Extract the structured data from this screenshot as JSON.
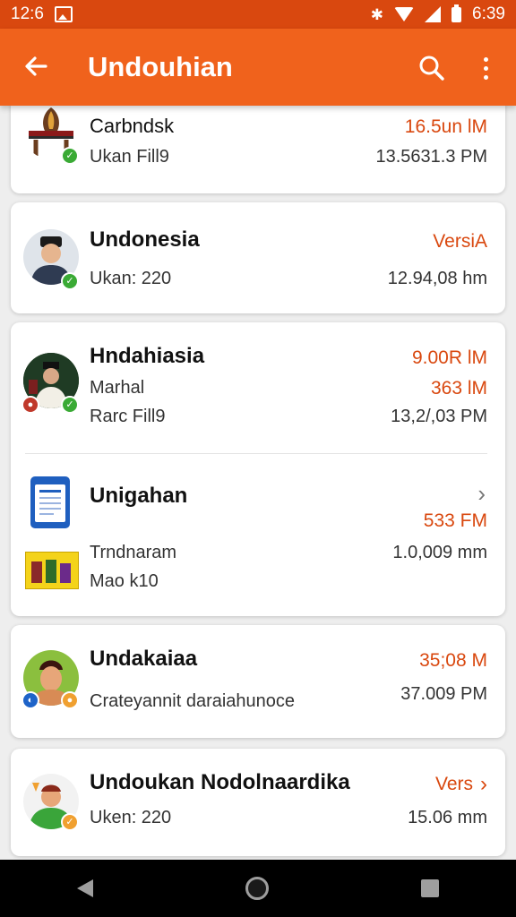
{
  "status_bar": {
    "time_left": "12:6",
    "time_right": "6:39",
    "icons": [
      "image-icon",
      "bluetooth-icon",
      "wifi-icon",
      "signal-icon",
      "battery-icon"
    ]
  },
  "app_bar": {
    "title": "Undouhian",
    "icons": [
      "back-arrow-icon",
      "search-icon",
      "more-vert-icon"
    ]
  },
  "colors": {
    "status_bar": "#d9480f",
    "app_bar": "#f0621c",
    "accent_text": "#d9480f",
    "verified_badge": "#3aaa35"
  },
  "items": [
    {
      "name": "Carbndsk",
      "sub": "Ukan Fill9",
      "right_top": "16.5un lM",
      "right_bottom": "13.5631.3 PM",
      "badge": "check-badge"
    },
    {
      "name": "Undonesia",
      "sub": "Ukan: 220",
      "right_top": "VersiA",
      "right_bottom": "12.94,08 hm",
      "badge": "check-badge"
    },
    {
      "name": "Hndahiasia",
      "sub1": "Marhal",
      "sub2": "Rarc Fill9",
      "right_1": "9.00R lM",
      "right_2": "363 lM",
      "right_3": "13,2/,03 PM",
      "badges": [
        "red-badge",
        "check-badge"
      ]
    },
    {
      "name": "Unigahan",
      "right_top": "533 FM",
      "sub1": "Trndnaram",
      "sub2": "Mao k10",
      "right_bottom": "1.0,009 mm",
      "icons": [
        "document-icon",
        "thumbnail-icon",
        "chevron-right-icon"
      ]
    },
    {
      "name": "Undakaiaa",
      "sub": "Crateyannit daraiahunoce",
      "right_top": "35;08 M",
      "right_bottom": "37.009 PM",
      "badges": [
        "blue-badge",
        "orange-badge"
      ]
    },
    {
      "name": "Undoukan Nodolnaardika",
      "sub": "Uken: 220",
      "right_top": "Vers",
      "right_bottom": "15.06 mm",
      "icons": [
        "chevron-right-icon"
      ]
    }
  ],
  "nav_bar": {
    "icons": [
      "nav-back-icon",
      "nav-home-icon",
      "nav-recents-icon"
    ]
  }
}
